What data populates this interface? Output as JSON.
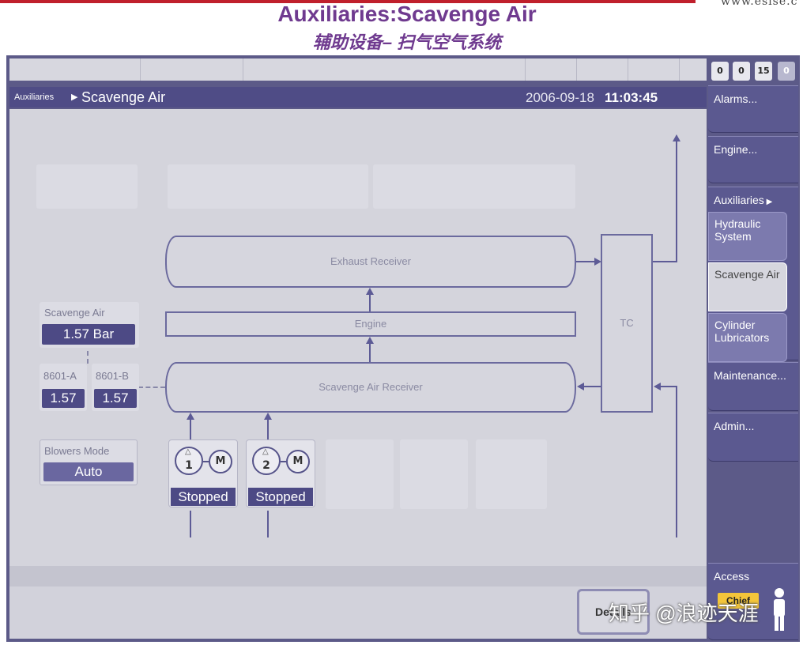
{
  "slide": {
    "url_fragment": "www.eslse.c",
    "title": "Auxiliaries:Scavenge Air",
    "subtitle": "辅助设备– 扫气空气系统"
  },
  "counters": [
    "0",
    "0",
    "15",
    "0"
  ],
  "header": {
    "breadcrumb_parent": "Auxiliaries",
    "breadcrumb_current": "Scavenge Air",
    "date": "2006-09-18",
    "time": "11:03:45"
  },
  "diagram": {
    "exhaust_receiver": "Exhaust Receiver",
    "engine": "Engine",
    "scavenge_air_receiver": "Scavenge Air Receiver",
    "tc": "TC"
  },
  "scavenge_air": {
    "label": "Scavenge Air",
    "value": "1.57 Bar"
  },
  "sensors": [
    {
      "label": "8601-A",
      "value": "1.57"
    },
    {
      "label": "8601-B",
      "value": "1.57"
    }
  ],
  "blowers_mode": {
    "label": "Blowers Mode",
    "value": "Auto"
  },
  "blowers": [
    {
      "number": "1",
      "motor": "M",
      "status": "Stopped"
    },
    {
      "number": "2",
      "motor": "M",
      "status": "Stopped"
    }
  ],
  "menu": {
    "alarms": "Alarms...",
    "engine": "Engine...",
    "auxiliaries": "Auxiliaries",
    "hydraulic_system": "Hydraulic System",
    "scavenge_air": "Scavenge Air",
    "cylinder_lubricators": "Cylinder Lubricators",
    "maintenance": "Maintenance...",
    "admin": "Admin..."
  },
  "details_button": "Details",
  "access": {
    "label": "Access",
    "level": "Chief"
  },
  "watermark": "知乎 @浪迹天涯",
  "colors": {
    "title": "#6f3a8f",
    "frame": "#5c5a88",
    "header": "#4f4c86",
    "accent_line": "#5d5b96",
    "chief_badge": "#f3c53a"
  }
}
